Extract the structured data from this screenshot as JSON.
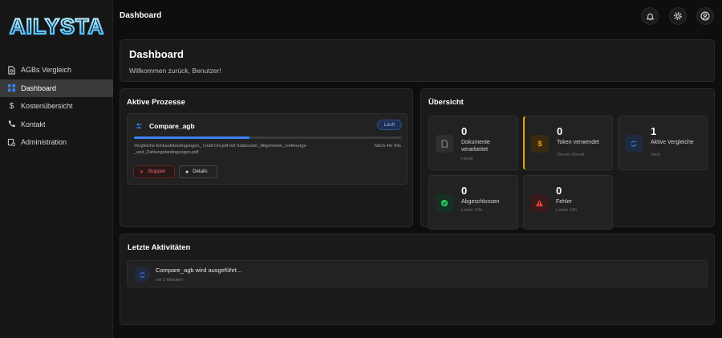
{
  "app": {
    "logo_text": "AILYSTA"
  },
  "sidebar": {
    "items": [
      {
        "label": "AGBs Vergleich",
        "icon": "document-compare-icon",
        "active": false
      },
      {
        "label": "Dashboard",
        "icon": "grid-icon",
        "active": true
      },
      {
        "label": "Kostenübersicht",
        "icon": "dollar-icon",
        "active": false
      },
      {
        "label": "Kontakt",
        "icon": "phone-icon",
        "active": false
      },
      {
        "label": "Administration",
        "icon": "admin-icon",
        "active": false
      }
    ]
  },
  "header": {
    "title": "Dashboard",
    "icons": [
      "bell-icon",
      "gear-icon",
      "user-circle-icon"
    ]
  },
  "welcome": {
    "title": "Dashboard",
    "subtitle": "Willkommen zurück, Benutzer!"
  },
  "processes": {
    "title": "Aktive Prozesse",
    "items": [
      {
        "name": "Compare_agb",
        "status": "Läuft",
        "progress_percent": 43,
        "description": "Vergleiche Einkaufsbedingungen_ Lindt CH.pdf mit Südzucker_Allgemeine_Lieferungs-_und_Zahlungsbedingungen.pdf",
        "eta": "Noch 4m 43s",
        "stop_label": "Stoppen",
        "details_label": "Details"
      }
    ]
  },
  "overview": {
    "title": "Übersicht",
    "stats": [
      {
        "value": "0",
        "label": "Dokumente verarbeitet",
        "meta": "Heute",
        "icon": "document-icon",
        "color": "#9a9a9a"
      },
      {
        "value": "0",
        "label": "Token verwendet",
        "meta": "Diesen Monat",
        "icon": "dollar-icon",
        "color": "#f0a500"
      },
      {
        "value": "1",
        "label": "Aktive Vergleiche",
        "meta": "Jetzt",
        "icon": "refresh-icon",
        "color": "#3b82f6"
      },
      {
        "value": "0",
        "label": "Abgeschlossen",
        "meta": "Letzte 24h",
        "icon": "check-circle-icon",
        "color": "#22c55e"
      },
      {
        "value": "0",
        "label": "Fehler",
        "meta": "Letzte 24h",
        "icon": "warning-icon",
        "color": "#ef4444"
      }
    ]
  },
  "activities": {
    "title": "Letzte Aktivitäten",
    "items": [
      {
        "text": "Compare_agb wird ausgeführt...",
        "time": "vor 2 Minuten",
        "icon": "refresh-icon"
      }
    ]
  }
}
